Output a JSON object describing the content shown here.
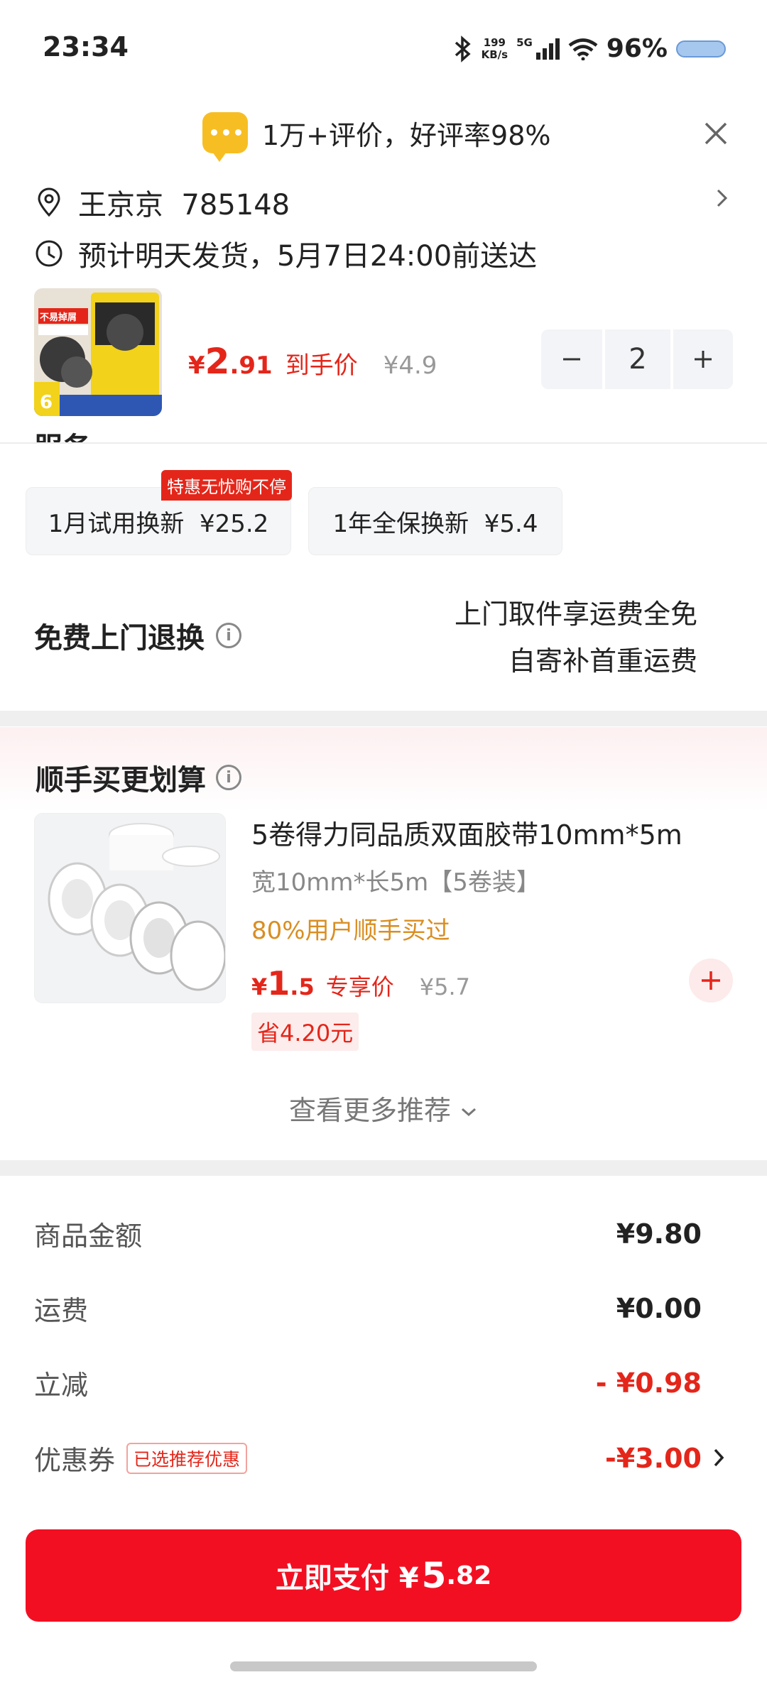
{
  "status_bar": {
    "time": "23:34",
    "net_speed_value": "199",
    "net_speed_unit": "KB/s",
    "network": "5G",
    "battery": "96%"
  },
  "review_banner": {
    "text": "1万+评价，好评率98%"
  },
  "address": {
    "name_line": "王京京  785148",
    "delivery": "预计明天发货，5月7日24:00前送达"
  },
  "product": {
    "price_symbol": "¥",
    "price_int": "2",
    "price_dec": ".91",
    "price_tag": "到手价",
    "original_price": "¥4.9",
    "quantity": "2",
    "thumb_badge": "不易掉屑",
    "thumb_count": "6"
  },
  "services": {
    "cut_title": "服务",
    "option1": "1月试用换新  ¥25.2",
    "option1_badge": "特惠无忧购不停",
    "option2": "1年全保换新  ¥5.4",
    "free_return_label": "免费上门退换",
    "free_return_line1": "上门取件享运费全免",
    "free_return_line2": "自寄补首重运费"
  },
  "recommend": {
    "title": "顺手买更划算",
    "item_name": "5卷得力同品质双面胶带10mm*5m",
    "item_spec": "宽10mm*长5m【5卷装】",
    "item_bought": "80%用户顺手买过",
    "price_symbol": "¥",
    "price_int": "1",
    "price_dec": ".5",
    "price_tag": "专享价",
    "original_price": "¥5.7",
    "save": "省4.20元",
    "see_more": "查看更多推荐"
  },
  "summary": {
    "goods_label": "商品金额",
    "goods_value": "¥9.80",
    "shipping_label": "运费",
    "shipping_value": "¥0.00",
    "discount_label": "立减",
    "discount_value": "- ¥0.98",
    "coupon_label": "优惠券",
    "coupon_tag": "已选推荐优惠",
    "coupon_value": "-¥3.00"
  },
  "pay": {
    "label": "立即支付 ¥",
    "amount_int": "5",
    "amount_dec": ".82"
  },
  "colors": {
    "accent_red": "#e4261a",
    "pay_button": "#f30f22",
    "review_icon": "#f7be24",
    "bought_text": "#d98e22"
  }
}
